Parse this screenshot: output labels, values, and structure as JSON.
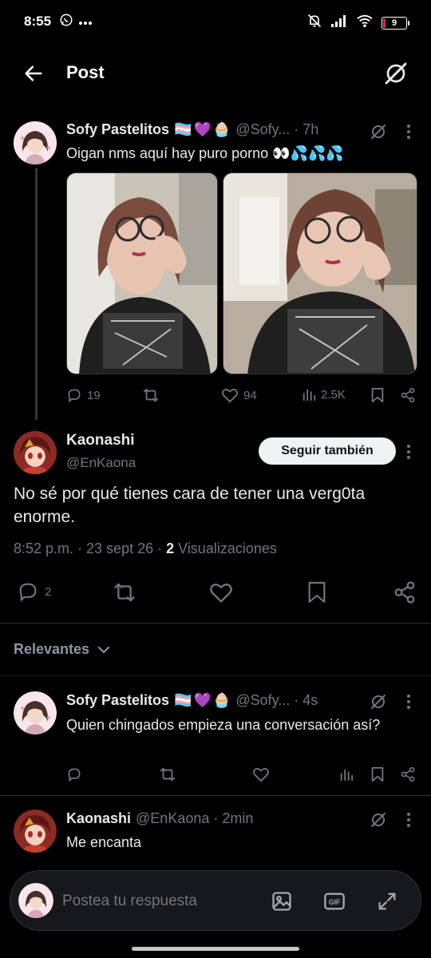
{
  "status_bar": {
    "time": "8:55",
    "battery": "9",
    "battery_fraction": 0.09,
    "battery_color": "#e0245e"
  },
  "header": {
    "title": "Post",
    "back_icon": "arrow-left-icon",
    "grok_icon": "grok-icon"
  },
  "parent_post": {
    "display_name": "Sofy Pastelitos",
    "handle": "@Sofy...",
    "time": "· 7h",
    "text": "Oigan nms aquí hay puro porno 👀💦💦💦",
    "emojis": [
      "🏳️‍⚧️",
      "💜",
      "🧁"
    ],
    "photos": [
      "selfie-photo-1",
      "selfie-photo-2"
    ],
    "replies": "19",
    "reposts": "",
    "likes": "94",
    "views": "2.5K"
  },
  "main_post": {
    "display_name": "Kaonashi",
    "handle": "@EnKaona",
    "follow_label": "Seguir también",
    "text": "No sé por qué tienes cara de tener una verg0ta enorme.",
    "timestamp": "8:52 p.m. · 23 sept 26 · ",
    "view_count": "2",
    "view_label": " Visualizaciones",
    "replies": "2"
  },
  "sort": {
    "label": "Relevantes"
  },
  "replies": [
    {
      "display_name": "Sofy Pastelitos",
      "handle": "@Sofy...",
      "time": "· 4s",
      "text": "Quien chingados empieza una conversación así?",
      "emojis": [
        "🏳️‍⚧️",
        "💜",
        "🧁"
      ]
    },
    {
      "display_name": "Kaonashi",
      "handle": "@EnKaona",
      "time": "· 2min",
      "text": "Me encanta"
    }
  ],
  "reply_box": {
    "placeholder": "Postea tu respuesta",
    "gif_label": "GIF"
  },
  "colors": {
    "background": "#000000",
    "text_primary": "#e7e9ea",
    "text_secondary": "#71767b",
    "border": "#2f3336"
  }
}
